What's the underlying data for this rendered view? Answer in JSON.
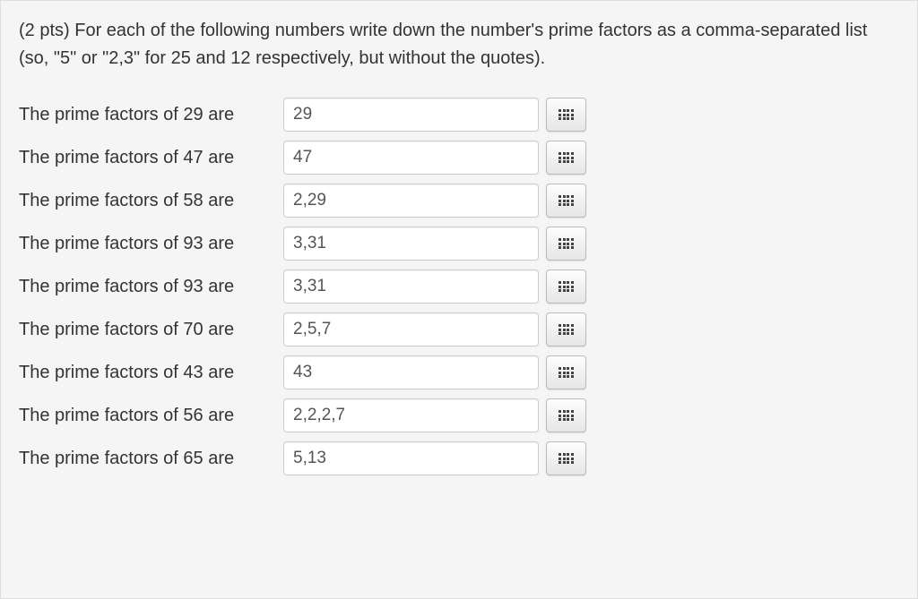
{
  "prompt": "(2 pts) For each of the following numbers write down the number's prime factors as a comma-separated list (so, \"5\" or \"2,3\" for 25 and 12 respectively, but without the quotes).",
  "rows": [
    {
      "label": "The prime factors of 29 are",
      "value": "29"
    },
    {
      "label": "The prime factors of 47 are",
      "value": "47"
    },
    {
      "label": "The prime factors of 58 are",
      "value": "2,29"
    },
    {
      "label": "The prime factors of 93 are",
      "value": "3,31"
    },
    {
      "label": "The prime factors of 93 are",
      "value": "3,31"
    },
    {
      "label": "The prime factors of 70 are",
      "value": "2,5,7"
    },
    {
      "label": "The prime factors of 43 are",
      "value": "43"
    },
    {
      "label": "The prime factors of 56 are",
      "value": "2,2,2,7"
    },
    {
      "label": "The prime factors of 65 are",
      "value": "5,13"
    }
  ]
}
